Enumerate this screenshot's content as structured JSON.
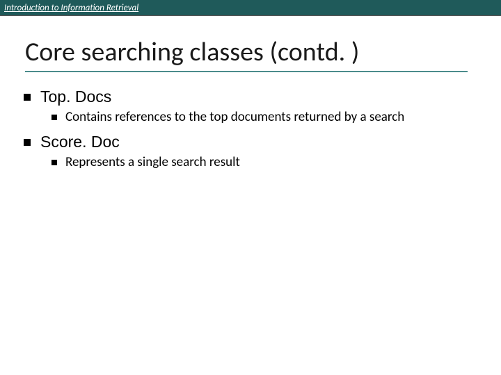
{
  "header": {
    "course_label": "Introduction to Information Retrieval"
  },
  "title": "Core searching classes (contd. )",
  "bullets": [
    {
      "label": "Top. Docs",
      "children": [
        {
          "label": "Contains references to the top documents returned by a search"
        }
      ]
    },
    {
      "label": "Score. Doc",
      "children": [
        {
          "label": "Represents a single search result"
        }
      ]
    }
  ]
}
